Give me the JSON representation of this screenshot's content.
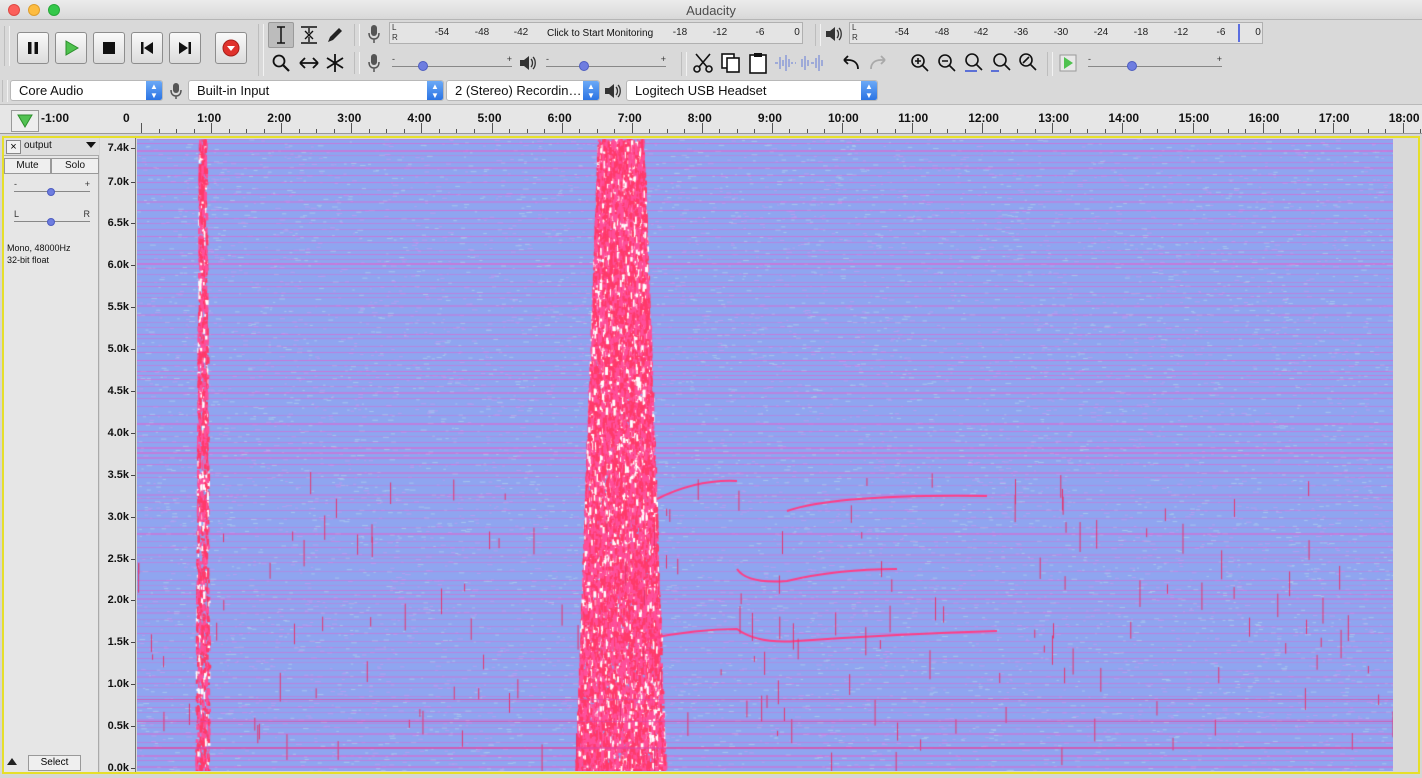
{
  "window": {
    "title": "Audacity"
  },
  "meters": {
    "record_ticks": [
      "-54",
      "-48",
      "-42",
      "-18",
      "-12",
      "-6",
      "0"
    ],
    "monitor_prompt": "Click to Start Monitoring",
    "playback_ticks": [
      "-54",
      "-48",
      "-42",
      "-36",
      "-30",
      "-24",
      "-18",
      "-12",
      "-6",
      "0"
    ],
    "left_channel": "L",
    "right_channel": "R"
  },
  "sliders": {
    "minus": "-",
    "plus": "+",
    "left": "L",
    "right": "R"
  },
  "device_toolbar": {
    "host": "Core Audio",
    "recording_device": "Built-in Input",
    "recording_channels": "2 (Stereo) Recordin…",
    "playback_device": "Logitech USB Headset"
  },
  "timeline": {
    "labels": [
      "-1:00",
      "0",
      "1:00",
      "2:00",
      "3:00",
      "4:00",
      "5:00",
      "6:00",
      "7:00",
      "8:00",
      "9:00",
      "10:00",
      "11:00",
      "12:00",
      "13:00",
      "14:00",
      "15:00",
      "16:00",
      "17:00",
      "18:00"
    ]
  },
  "track": {
    "name": "output",
    "close": "×",
    "mute_label": "Mute",
    "solo_label": "Solo",
    "format_line1": "Mono, 48000Hz",
    "format_line2": "32-bit float",
    "select_label": "Select"
  },
  "spectrogram": {
    "y_labels": [
      "7.4k",
      "7.0k",
      "6.5k",
      "6.0k",
      "5.5k",
      "5.0k",
      "4.5k",
      "4.0k",
      "3.5k",
      "3.0k",
      "2.5k",
      "2.0k",
      "1.5k",
      "1.0k",
      "0.5k",
      "0.0k"
    ],
    "colors": {
      "background": "#8fa5f0",
      "band": "#e85ccd",
      "hot": "#ff3a6a",
      "peak": "#ffffff"
    }
  }
}
